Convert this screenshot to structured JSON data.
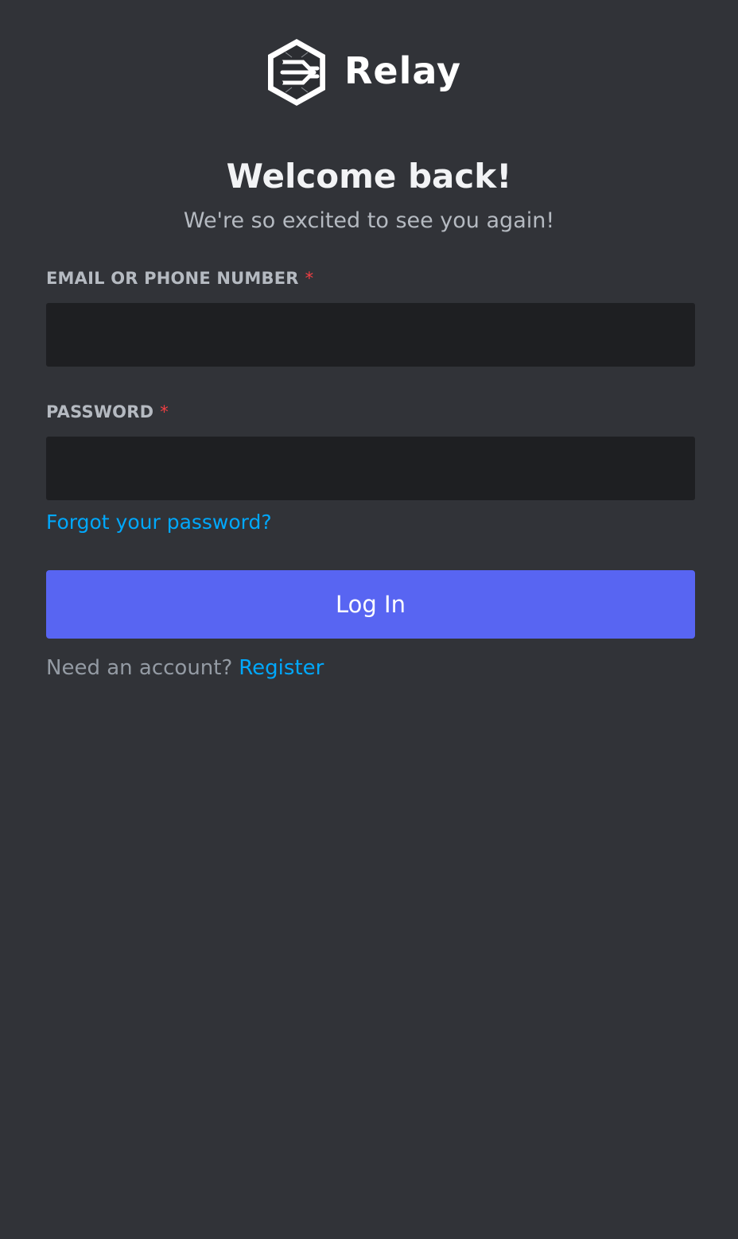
{
  "brand": {
    "name": "Relay",
    "logo_icon": "circuit-hexagon-icon"
  },
  "header": {
    "title": "Welcome back!",
    "subtitle": "We're so excited to see you again!"
  },
  "form": {
    "email_label": "EMAIL OR PHONE NUMBER",
    "email_value": "",
    "password_label": "PASSWORD",
    "password_value": "",
    "required_marker": "*",
    "forgot_link": "Forgot your password?",
    "login_button": "Log In"
  },
  "footer": {
    "prompt": "Need an account?",
    "register_link": "Register"
  },
  "colors": {
    "background": "#313338",
    "input_background": "#1e1f22",
    "accent_button": "#5865f2",
    "link": "#00a8fc",
    "required": "#f23f43"
  }
}
